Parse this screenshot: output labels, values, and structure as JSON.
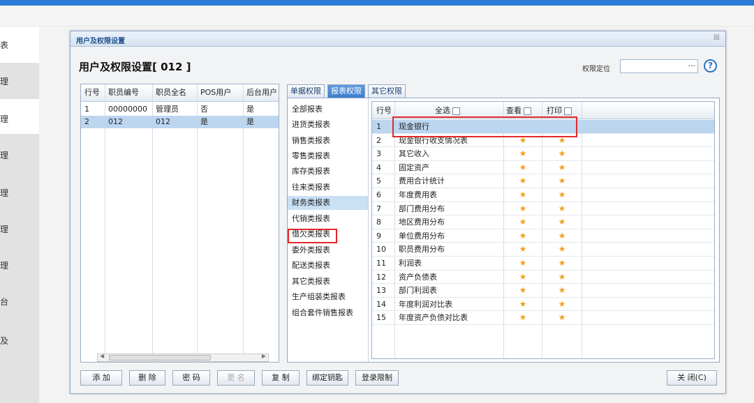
{
  "nav": {
    "items": [
      "表",
      "理",
      "理",
      "理",
      "理",
      "理",
      "理",
      "台",
      "及"
    ]
  },
  "dialog": {
    "title": "用户及权限设置",
    "close_glyph": "☒",
    "heading": "用户及权限设置[ 012 ]",
    "locate_label": "权限定位",
    "locate_value": "",
    "locate_button": "···",
    "help": "?"
  },
  "users": {
    "headers": [
      "行号",
      "职员编号",
      "职员全名",
      "POS用户",
      "后台用户"
    ],
    "rows": [
      [
        "1",
        "00000000",
        "管理员",
        "否",
        "是"
      ],
      [
        "2",
        "012",
        "012",
        "是",
        "是"
      ]
    ],
    "selected_row": 1
  },
  "tabs": [
    {
      "label": "单据权限"
    },
    {
      "label": "报表权限"
    },
    {
      "label": "其它权限"
    }
  ],
  "active_tab": 1,
  "categories": [
    "全部报表",
    "进货类报表",
    "销售类报表",
    "零售类报表",
    "库存类报表",
    "往来类报表",
    "财务类报表",
    "代销类报表",
    "借欠类报表",
    "委外类报表",
    "配送类报表",
    "其它类报表",
    "生产组装类报表",
    "组合套件销售报表"
  ],
  "selected_category": 6,
  "reports": {
    "headers": {
      "row": "行号",
      "select_all": "全选",
      "view": "查看",
      "print": "打印"
    },
    "star": "★",
    "rows": [
      {
        "no": "1",
        "name": "现金银行",
        "view": false,
        "print": false
      },
      {
        "no": "2",
        "name": "现金银行收支情况表",
        "view": true,
        "print": true
      },
      {
        "no": "3",
        "name": "其它收入",
        "view": true,
        "print": true
      },
      {
        "no": "4",
        "name": "固定资产",
        "view": true,
        "print": true
      },
      {
        "no": "5",
        "name": "费用合计统计",
        "view": true,
        "print": true
      },
      {
        "no": "6",
        "name": "年度费用表",
        "view": true,
        "print": true
      },
      {
        "no": "7",
        "name": "部门费用分布",
        "view": true,
        "print": true
      },
      {
        "no": "8",
        "name": "地区费用分布",
        "view": true,
        "print": true
      },
      {
        "no": "9",
        "name": "单位费用分布",
        "view": true,
        "print": true
      },
      {
        "no": "10",
        "name": "职员费用分布",
        "view": true,
        "print": true
      },
      {
        "no": "11",
        "name": "利润表",
        "view": true,
        "print": true
      },
      {
        "no": "12",
        "name": "资产负债表",
        "view": true,
        "print": true
      },
      {
        "no": "13",
        "name": "部门利润表",
        "view": true,
        "print": true
      },
      {
        "no": "14",
        "name": "年度利润对比表",
        "view": true,
        "print": true
      },
      {
        "no": "15",
        "name": "年度资产负债对比表",
        "view": true,
        "print": true
      }
    ]
  },
  "buttons": {
    "add": "添 加",
    "delete": "删 除",
    "password": "密 码",
    "rename": "更 名",
    "copy": "复 制",
    "bind_key": "绑定钥匙",
    "login_limit": "登录限制",
    "close": "关 闭(C)"
  },
  "colors": {
    "accent": "#2b7bd6",
    "selected_row": "#bcd6f0",
    "highlight_box": "#e0282a",
    "star": "#f0a020"
  }
}
